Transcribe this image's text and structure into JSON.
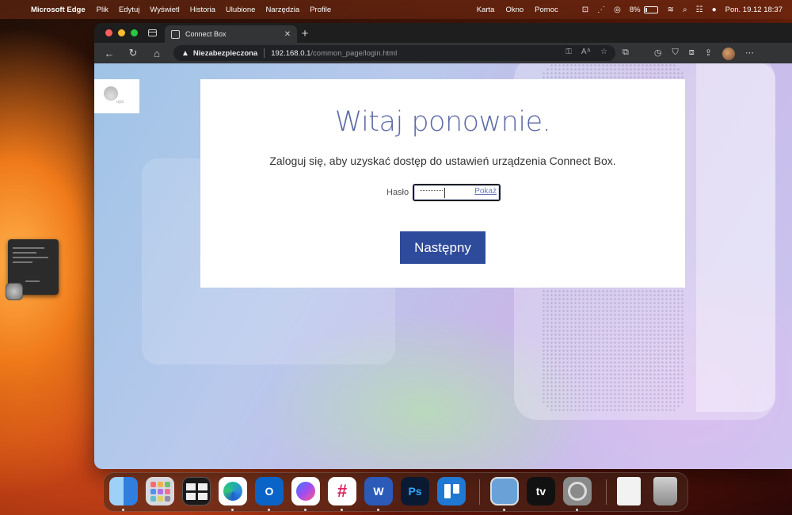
{
  "menubar": {
    "app_name": "Microsoft Edge",
    "menus": [
      "Plik",
      "Edytuj",
      "Wyświetl",
      "Historia",
      "Ulubione",
      "Narzędzia",
      "Profile"
    ],
    "right_menus": [
      "Karta",
      "Okno",
      "Pomoc"
    ],
    "battery_percent": "8%",
    "clock": "Pon. 19.12  18:37"
  },
  "browser": {
    "tab": {
      "title": "Connect Box",
      "close": "✕"
    },
    "new_tab": "+",
    "address": {
      "security_label": "Niezabezpieczona",
      "url_host": "192.168.0.1",
      "url_path": "/common_page/login.html"
    }
  },
  "page": {
    "logo_text": "upc",
    "welcome": "Witaj ponownie.",
    "subtitle": "Zaloguj się, aby uzyskać dostęp do ustawień urządzenia Connect Box.",
    "password_label": "Hasło",
    "password_masked": "···············",
    "show_password": "Pokaż",
    "next_button": "Następny"
  },
  "dock": {
    "apps": [
      {
        "name": "finder-icon",
        "label": "",
        "color": "#3a8ee6"
      },
      {
        "name": "launchpad-icon",
        "label": "",
        "color": "#d8d8e0"
      },
      {
        "name": "mission-control-icon",
        "label": "",
        "color": "#1a1a1a"
      },
      {
        "name": "edge-icon",
        "label": "",
        "color": "#ffffff"
      },
      {
        "name": "outlook-icon",
        "label": "O",
        "color": "#0a64c8"
      },
      {
        "name": "messenger-icon",
        "label": "",
        "color": "#ffffff"
      },
      {
        "name": "slack-icon",
        "label": "",
        "color": "#ffffff"
      },
      {
        "name": "word-icon",
        "label": "W",
        "color": "#2b5ab8"
      },
      {
        "name": "photoshop-icon",
        "label": "Ps",
        "color": "#0a1a33"
      },
      {
        "name": "trello-icon",
        "label": "",
        "color": "#1f78d1"
      },
      {
        "name": "preview-icon",
        "label": "",
        "color": "#6aa2d8"
      },
      {
        "name": "apple-tv-icon",
        "label": "tv",
        "color": "#111111"
      },
      {
        "name": "system-settings-icon",
        "label": "",
        "color": "#8a8a8a"
      },
      {
        "name": "document-icon",
        "label": "",
        "color": "#f2f2f2"
      },
      {
        "name": "trash-icon",
        "label": "",
        "color": "#b8b8b8"
      }
    ]
  }
}
